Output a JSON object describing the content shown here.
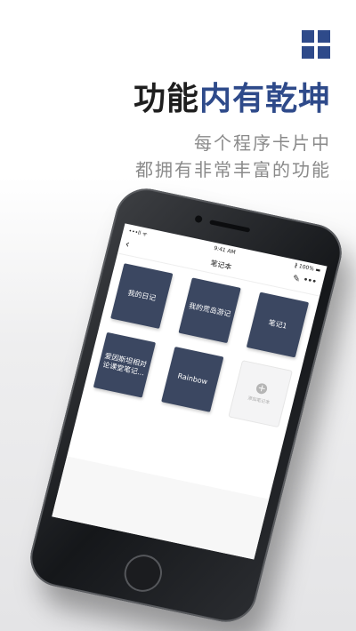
{
  "promo": {
    "headline_plain": "功能",
    "headline_accent": "内有乾坤",
    "subline_1": "每个程序卡片中",
    "subline_2": "都拥有非常丰富的功能",
    "accent_color": "#2e4a8a"
  },
  "phone": {
    "status": {
      "signal": "•••ll ᯤ",
      "time": "9:41 AM",
      "battery": "∦ 100% ▬"
    },
    "nav": {
      "back_icon": "‹",
      "title": "笔记本",
      "edit_icon": "✎",
      "more_icon": "•••"
    },
    "cards": [
      {
        "label": "我的日记"
      },
      {
        "label": "我的荒岛游记"
      },
      {
        "label": "笔记1"
      },
      {
        "label": "爱因斯坦相对论课堂笔记..."
      },
      {
        "label": "Rainbow"
      }
    ],
    "add_card": {
      "icon": "+",
      "label": "添加笔记本"
    },
    "card_color": "#3b4761"
  }
}
